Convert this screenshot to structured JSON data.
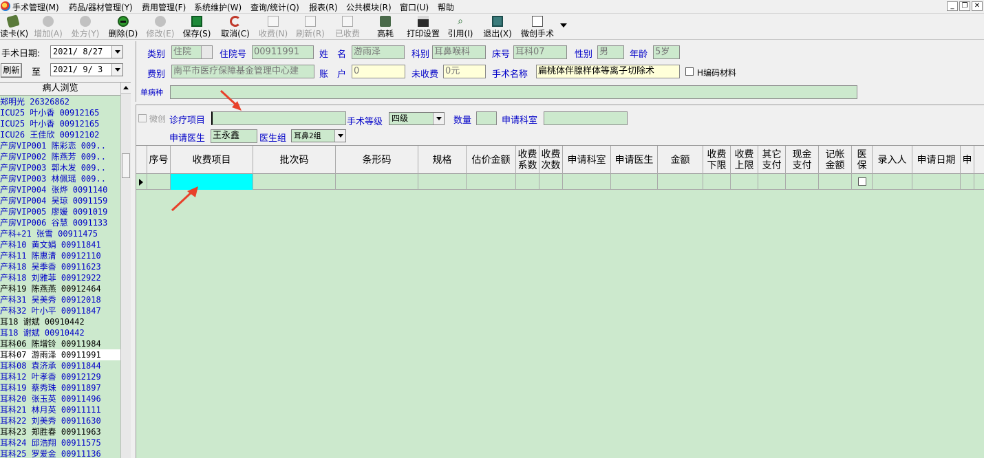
{
  "menu": [
    "手术管理(M)",
    "药品/器材管理(Y)",
    "费用管理(F)",
    "系统维护(W)",
    "查询/统计(Q)",
    "报表(R)",
    "公共模块(R)",
    "窗口(U)",
    "帮助"
  ],
  "toolbar": {
    "read_card": "读卡(K)",
    "add": "增加(A)",
    "prescription": "处方(Y)",
    "delete": "删除(D)",
    "modify": "修改(E)",
    "save": "保存(S)",
    "cancel": "取消(C)",
    "charge": "收费(N)",
    "refresh": "刷新(R)",
    "charged": "已收费",
    "high_cost": "高耗",
    "print_settings": "打印设置",
    "cite": "引用(I)",
    "exit": "退出(X)",
    "micro_surgery": "微创手术"
  },
  "left": {
    "date_label": "手术日期:",
    "date_from": "2021/ 8/27",
    "refresh_button": "刷新",
    "to_label": "至",
    "date_to": "2021/ 9/ 3",
    "list_header": "病人浏览",
    "patients": [
      {
        "text": " 郑明光 26326862",
        "style": "blue"
      },
      {
        "text": "ICU25 叶小香 00912165",
        "style": "blue"
      },
      {
        "text": "ICU25 叶小香 00912165",
        "style": "blue"
      },
      {
        "text": "ICU26 王佳欣 00912102",
        "style": "blue"
      },
      {
        "text": "产房VIP001 陈彩恋 009..",
        "style": "blue"
      },
      {
        "text": "产房VIP002 陈燕芳 009..",
        "style": "blue"
      },
      {
        "text": "产房VIP003 郭木发 009..",
        "style": "blue"
      },
      {
        "text": "产房VIP003 林佩瑶 009..",
        "style": "blue"
      },
      {
        "text": "产房VIP004 张烨 0091140",
        "style": "blue"
      },
      {
        "text": "产房VIP004 吴琼 0091159",
        "style": "blue"
      },
      {
        "text": "产房VIP005 廖媛 0091019",
        "style": "blue"
      },
      {
        "text": "产房VIP006 谷慧 0091133",
        "style": "blue"
      },
      {
        "text": "产科+21 张雪 00911475",
        "style": "blue"
      },
      {
        "text": "产科10 黄文娟 00911841",
        "style": "blue"
      },
      {
        "text": "产科11 陈惠清 00912110",
        "style": "blue"
      },
      {
        "text": "产科18 吴季香 00911623",
        "style": "blue"
      },
      {
        "text": "产科18 刘雅菲 00912922",
        "style": "blue"
      },
      {
        "text": "产科19 陈燕燕 00912464",
        "style": "black"
      },
      {
        "text": "产科31 吴美秀 00912018",
        "style": "blue"
      },
      {
        "text": "产科32 叶小平 00911847",
        "style": "blue"
      },
      {
        "text": "耳18 谢斌 00910442",
        "style": "black"
      },
      {
        "text": "耳18 谢斌 00910442",
        "style": "blue"
      },
      {
        "text": "耳科06 陈增铃 00911984",
        "style": "black"
      },
      {
        "text": "耳科07 游雨泽 00911991",
        "style": "sel"
      },
      {
        "text": "耳科08 袁济承 00911844",
        "style": "blue"
      },
      {
        "text": "耳科12 叶孝香 00912129",
        "style": "blue"
      },
      {
        "text": "耳科19 蔡秀珠 00911897",
        "style": "blue"
      },
      {
        "text": "耳科20 张玉英 00911496",
        "style": "blue"
      },
      {
        "text": "耳科21 林月英 00911111",
        "style": "blue"
      },
      {
        "text": "耳科22 刘美秀 00911630",
        "style": "blue"
      },
      {
        "text": "耳科23 郑胜春 00911963",
        "style": "black"
      },
      {
        "text": "耳科24 邱浩翔 00911575",
        "style": "blue"
      },
      {
        "text": "耳科25 罗爱金 00911136",
        "style": "blue"
      }
    ]
  },
  "form": {
    "category_label": "类别",
    "category_value": "住院",
    "inpatient_no_label": "住院号",
    "inpatient_no_value": "00911991",
    "name_label": "姓　名",
    "name_value": "游雨泽",
    "dept_label": "科别",
    "dept_value": "耳鼻喉科",
    "bed_label": "床号",
    "bed_value": "耳科07",
    "gender_label": "性别",
    "gender_value": "男",
    "age_label": "年龄",
    "age_value": "5岁",
    "fee_type_label": "费别",
    "fee_type_value": "南平市医疗保障基金管理中心建",
    "account_label": "账　户",
    "account_value": "0",
    "uncharged_label": "未收费",
    "uncharged_value": "0元",
    "surgery_name_label": "手术名称",
    "surgery_name_value": "扁桃体伴腺样体等离子切除术",
    "h_code_label": "H编码材料",
    "single_disease_label": "单病种"
  },
  "sub": {
    "micro_label": "微创",
    "diagnosis_item_label": "诊疗项目",
    "surgery_grade_label": "手术等级",
    "surgery_grade_value": "四级",
    "quantity_label": "数量",
    "apply_dept_label": "申请科室",
    "apply_doctor_label": "申请医生",
    "apply_doctor_value": "王永鑫",
    "doctor_group_label": "医生组",
    "doctor_group_value": "耳鼻2组"
  },
  "grid": {
    "columns": [
      "",
      "序号",
      "收费项目",
      "批次码",
      "条形码",
      "规格",
      "估价金额",
      "收费\n系数",
      "收费\n次数",
      "申请科室",
      "申请医生",
      "金额",
      "收费\n下限",
      "收费\n上限",
      "其它\n支付",
      "现金\n支付",
      "记帐\n金额",
      "医\n保",
      "录入人",
      "申请日期",
      "申"
    ]
  },
  "colors": {
    "field_green": "#cce9cd",
    "active_cell": "#00ffff",
    "label_blue": "#0000c8",
    "arrow_red": "#e8402a"
  }
}
